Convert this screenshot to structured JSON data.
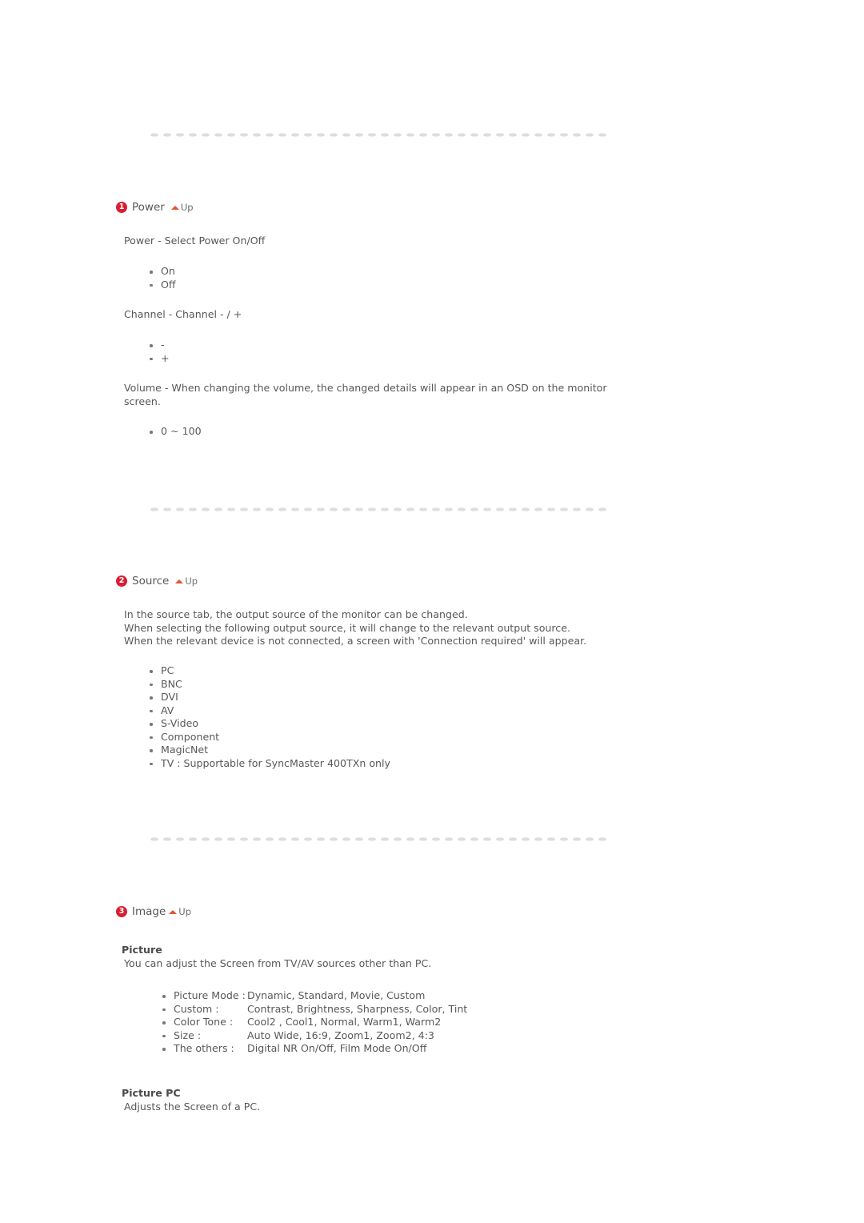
{
  "document": {
    "type": "monitor-manual-page",
    "separator_icon": "dotted-line-separator",
    "up_link_label": "Up",
    "up_link_icon": "triangle-up-icon"
  },
  "sections": [
    {
      "number": "1",
      "title": "Power",
      "blocks": {
        "power_line": "Power - Select Power On/Off",
        "power_items": [
          "On",
          "Off"
        ],
        "channel_line": "Channel - Channel - / +",
        "channel_items": [
          "-",
          "+"
        ],
        "volume_line": "Volume - When changing the volume, the changed details will appear in an OSD on the monitor screen.",
        "volume_items": [
          "0 ~ 100"
        ]
      }
    },
    {
      "number": "2",
      "title": "Source",
      "blocks": {
        "intro_line1": "In the source tab, the output source of the monitor can be changed.",
        "intro_line2": "When selecting the following output source, it will change to the relevant output source.",
        "intro_line3": "When the relevant device is not connected, a screen with 'Connection required' will appear.",
        "source_items": [
          "PC",
          "BNC",
          "DVI",
          "AV",
          "S-Video",
          "Component",
          "MagicNet",
          "TV : Supportable for SyncMaster 400TXn only"
        ]
      }
    },
    {
      "number": "3",
      "title": "Image",
      "blocks": {
        "picture_heading": "Picture",
        "picture_desc": "You can adjust the Screen from TV/AV sources other than PC.",
        "picture_items": [
          {
            "key": "Picture Mode :",
            "value": "Dynamic, Standard, Movie, Custom"
          },
          {
            "key": "Custom :",
            "value": "Contrast, Brightness, Sharpness, Color, Tint"
          },
          {
            "key": "Color Tone :",
            "value": "Cool2 , Cool1, Normal, Warm1, Warm2"
          },
          {
            "key": "Size :",
            "value": "Auto Wide, 16:9, Zoom1, Zoom2, 4:3"
          },
          {
            "key": "The others :",
            "value": "Digital NR On/Off, Film Mode On/Off"
          }
        ],
        "picture_pc_heading": "Picture PC",
        "picture_pc_desc": "Adjusts the Screen of a PC."
      }
    }
  ],
  "colors": {
    "badge_red": "#d81f33",
    "up_arrow_orange": "#e0562e",
    "body_text": "#58585a",
    "separator_dot": "#dedede"
  }
}
